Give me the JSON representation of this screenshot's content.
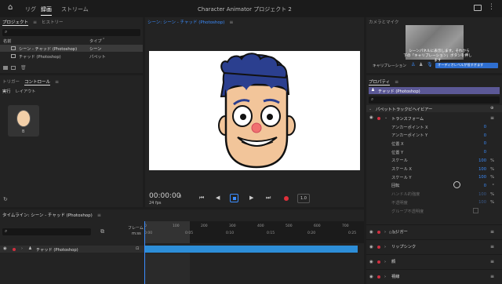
{
  "header": {
    "home": "⌂",
    "tabs": [
      "リグ",
      "録画",
      "ストリーム"
    ],
    "active_tab": "録画",
    "title": "Character Animator プロジェクト 2"
  },
  "project_panel": {
    "tabs": [
      "プロジェクト",
      "ヒストリー"
    ],
    "col_name": "名前",
    "col_type": "タイプ",
    "items": [
      {
        "name": "シーン - チャッド (Photoshop)",
        "type": "シーン"
      },
      {
        "name": "チャッド (Photoshop)",
        "type": "パペット"
      }
    ]
  },
  "control_panel": {
    "tabs": [
      "トリガー",
      "コントロール"
    ],
    "subtabs": [
      "実行",
      "レイアウト"
    ],
    "tile_label": "B"
  },
  "scene_panel": {
    "tab": "シーン: シーン - チャッド (Photoshop)",
    "timecode": "00:00:00",
    "frame": "0",
    "fps": "24 fps",
    "zoom": "1.0"
  },
  "camera_panel": {
    "tab": "カメラとマイク",
    "overlay_line1": "シーンパネルに表示します。それから",
    "overlay_line2": "下の「キャリブレーション」ボタンを押します",
    "calibrate_label": "キャリブレーション",
    "mic_status": "オーディオレベルが低すぎます"
  },
  "properties_panel": {
    "tab": "プロパティ",
    "puppet": "チャッド (Photoshop)",
    "section": "パペットトラックビヘイビアー",
    "transform": "トランスフォーム",
    "props": [
      {
        "label": "アンカーポイント X",
        "value": "0",
        "unit": ""
      },
      {
        "label": "アンカーポイント Y",
        "value": "0",
        "unit": ""
      },
      {
        "label": "位置 X",
        "value": "0",
        "unit": ""
      },
      {
        "label": "位置 Y",
        "value": "0",
        "unit": ""
      },
      {
        "label": "スケール",
        "value": "100",
        "unit": "%"
      },
      {
        "label": "スケール X",
        "value": "100",
        "unit": "%"
      },
      {
        "label": "スケール Y",
        "value": "100",
        "unit": "%"
      },
      {
        "label": "回転",
        "value": "0",
        "unit": "°"
      },
      {
        "label": "ハンドル的強度",
        "value": "100",
        "unit": "%"
      },
      {
        "label": "不透明度",
        "value": "100",
        "unit": "%"
      },
      {
        "label": "グループ不透明度",
        "value": "",
        "unit": ""
      }
    ],
    "behaviors": [
      "トリガー",
      "リップシンク",
      "顔",
      "視線"
    ]
  },
  "timeline": {
    "tab": "タイムライン: シーン - チャッド (Photoshop)",
    "frame_label": "フレーム",
    "mmss_label": "m:ss",
    "frame_ticks": [
      "0",
      "100",
      "200",
      "300",
      "400",
      "500",
      "600",
      "700"
    ],
    "time_ticks": [
      "0:00",
      "0:05",
      "0:10",
      "0:15",
      "0:20",
      "0:25",
      "0:30"
    ],
    "track": "チャッド (Photoshop)"
  }
}
